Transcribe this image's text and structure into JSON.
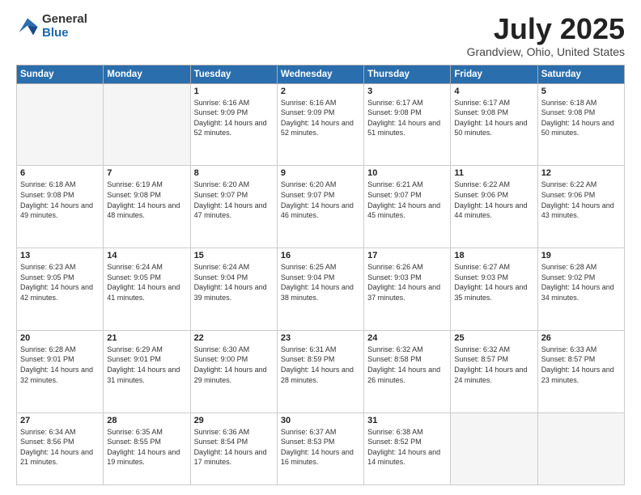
{
  "logo": {
    "general": "General",
    "blue": "Blue"
  },
  "title": "July 2025",
  "location": "Grandview, Ohio, United States",
  "days_of_week": [
    "Sunday",
    "Monday",
    "Tuesday",
    "Wednesday",
    "Thursday",
    "Friday",
    "Saturday"
  ],
  "weeks": [
    [
      {
        "day": "",
        "info": ""
      },
      {
        "day": "",
        "info": ""
      },
      {
        "day": "1",
        "info": "Sunrise: 6:16 AM\nSunset: 9:09 PM\nDaylight: 14 hours and 52 minutes."
      },
      {
        "day": "2",
        "info": "Sunrise: 6:16 AM\nSunset: 9:09 PM\nDaylight: 14 hours and 52 minutes."
      },
      {
        "day": "3",
        "info": "Sunrise: 6:17 AM\nSunset: 9:08 PM\nDaylight: 14 hours and 51 minutes."
      },
      {
        "day": "4",
        "info": "Sunrise: 6:17 AM\nSunset: 9:08 PM\nDaylight: 14 hours and 50 minutes."
      },
      {
        "day": "5",
        "info": "Sunrise: 6:18 AM\nSunset: 9:08 PM\nDaylight: 14 hours and 50 minutes."
      }
    ],
    [
      {
        "day": "6",
        "info": "Sunrise: 6:18 AM\nSunset: 9:08 PM\nDaylight: 14 hours and 49 minutes."
      },
      {
        "day": "7",
        "info": "Sunrise: 6:19 AM\nSunset: 9:08 PM\nDaylight: 14 hours and 48 minutes."
      },
      {
        "day": "8",
        "info": "Sunrise: 6:20 AM\nSunset: 9:07 PM\nDaylight: 14 hours and 47 minutes."
      },
      {
        "day": "9",
        "info": "Sunrise: 6:20 AM\nSunset: 9:07 PM\nDaylight: 14 hours and 46 minutes."
      },
      {
        "day": "10",
        "info": "Sunrise: 6:21 AM\nSunset: 9:07 PM\nDaylight: 14 hours and 45 minutes."
      },
      {
        "day": "11",
        "info": "Sunrise: 6:22 AM\nSunset: 9:06 PM\nDaylight: 14 hours and 44 minutes."
      },
      {
        "day": "12",
        "info": "Sunrise: 6:22 AM\nSunset: 9:06 PM\nDaylight: 14 hours and 43 minutes."
      }
    ],
    [
      {
        "day": "13",
        "info": "Sunrise: 6:23 AM\nSunset: 9:05 PM\nDaylight: 14 hours and 42 minutes."
      },
      {
        "day": "14",
        "info": "Sunrise: 6:24 AM\nSunset: 9:05 PM\nDaylight: 14 hours and 41 minutes."
      },
      {
        "day": "15",
        "info": "Sunrise: 6:24 AM\nSunset: 9:04 PM\nDaylight: 14 hours and 39 minutes."
      },
      {
        "day": "16",
        "info": "Sunrise: 6:25 AM\nSunset: 9:04 PM\nDaylight: 14 hours and 38 minutes."
      },
      {
        "day": "17",
        "info": "Sunrise: 6:26 AM\nSunset: 9:03 PM\nDaylight: 14 hours and 37 minutes."
      },
      {
        "day": "18",
        "info": "Sunrise: 6:27 AM\nSunset: 9:03 PM\nDaylight: 14 hours and 35 minutes."
      },
      {
        "day": "19",
        "info": "Sunrise: 6:28 AM\nSunset: 9:02 PM\nDaylight: 14 hours and 34 minutes."
      }
    ],
    [
      {
        "day": "20",
        "info": "Sunrise: 6:28 AM\nSunset: 9:01 PM\nDaylight: 14 hours and 32 minutes."
      },
      {
        "day": "21",
        "info": "Sunrise: 6:29 AM\nSunset: 9:01 PM\nDaylight: 14 hours and 31 minutes."
      },
      {
        "day": "22",
        "info": "Sunrise: 6:30 AM\nSunset: 9:00 PM\nDaylight: 14 hours and 29 minutes."
      },
      {
        "day": "23",
        "info": "Sunrise: 6:31 AM\nSunset: 8:59 PM\nDaylight: 14 hours and 28 minutes."
      },
      {
        "day": "24",
        "info": "Sunrise: 6:32 AM\nSunset: 8:58 PM\nDaylight: 14 hours and 26 minutes."
      },
      {
        "day": "25",
        "info": "Sunrise: 6:32 AM\nSunset: 8:57 PM\nDaylight: 14 hours and 24 minutes."
      },
      {
        "day": "26",
        "info": "Sunrise: 6:33 AM\nSunset: 8:57 PM\nDaylight: 14 hours and 23 minutes."
      }
    ],
    [
      {
        "day": "27",
        "info": "Sunrise: 6:34 AM\nSunset: 8:56 PM\nDaylight: 14 hours and 21 minutes."
      },
      {
        "day": "28",
        "info": "Sunrise: 6:35 AM\nSunset: 8:55 PM\nDaylight: 14 hours and 19 minutes."
      },
      {
        "day": "29",
        "info": "Sunrise: 6:36 AM\nSunset: 8:54 PM\nDaylight: 14 hours and 17 minutes."
      },
      {
        "day": "30",
        "info": "Sunrise: 6:37 AM\nSunset: 8:53 PM\nDaylight: 14 hours and 16 minutes."
      },
      {
        "day": "31",
        "info": "Sunrise: 6:38 AM\nSunset: 8:52 PM\nDaylight: 14 hours and 14 minutes."
      },
      {
        "day": "",
        "info": ""
      },
      {
        "day": "",
        "info": ""
      }
    ]
  ]
}
